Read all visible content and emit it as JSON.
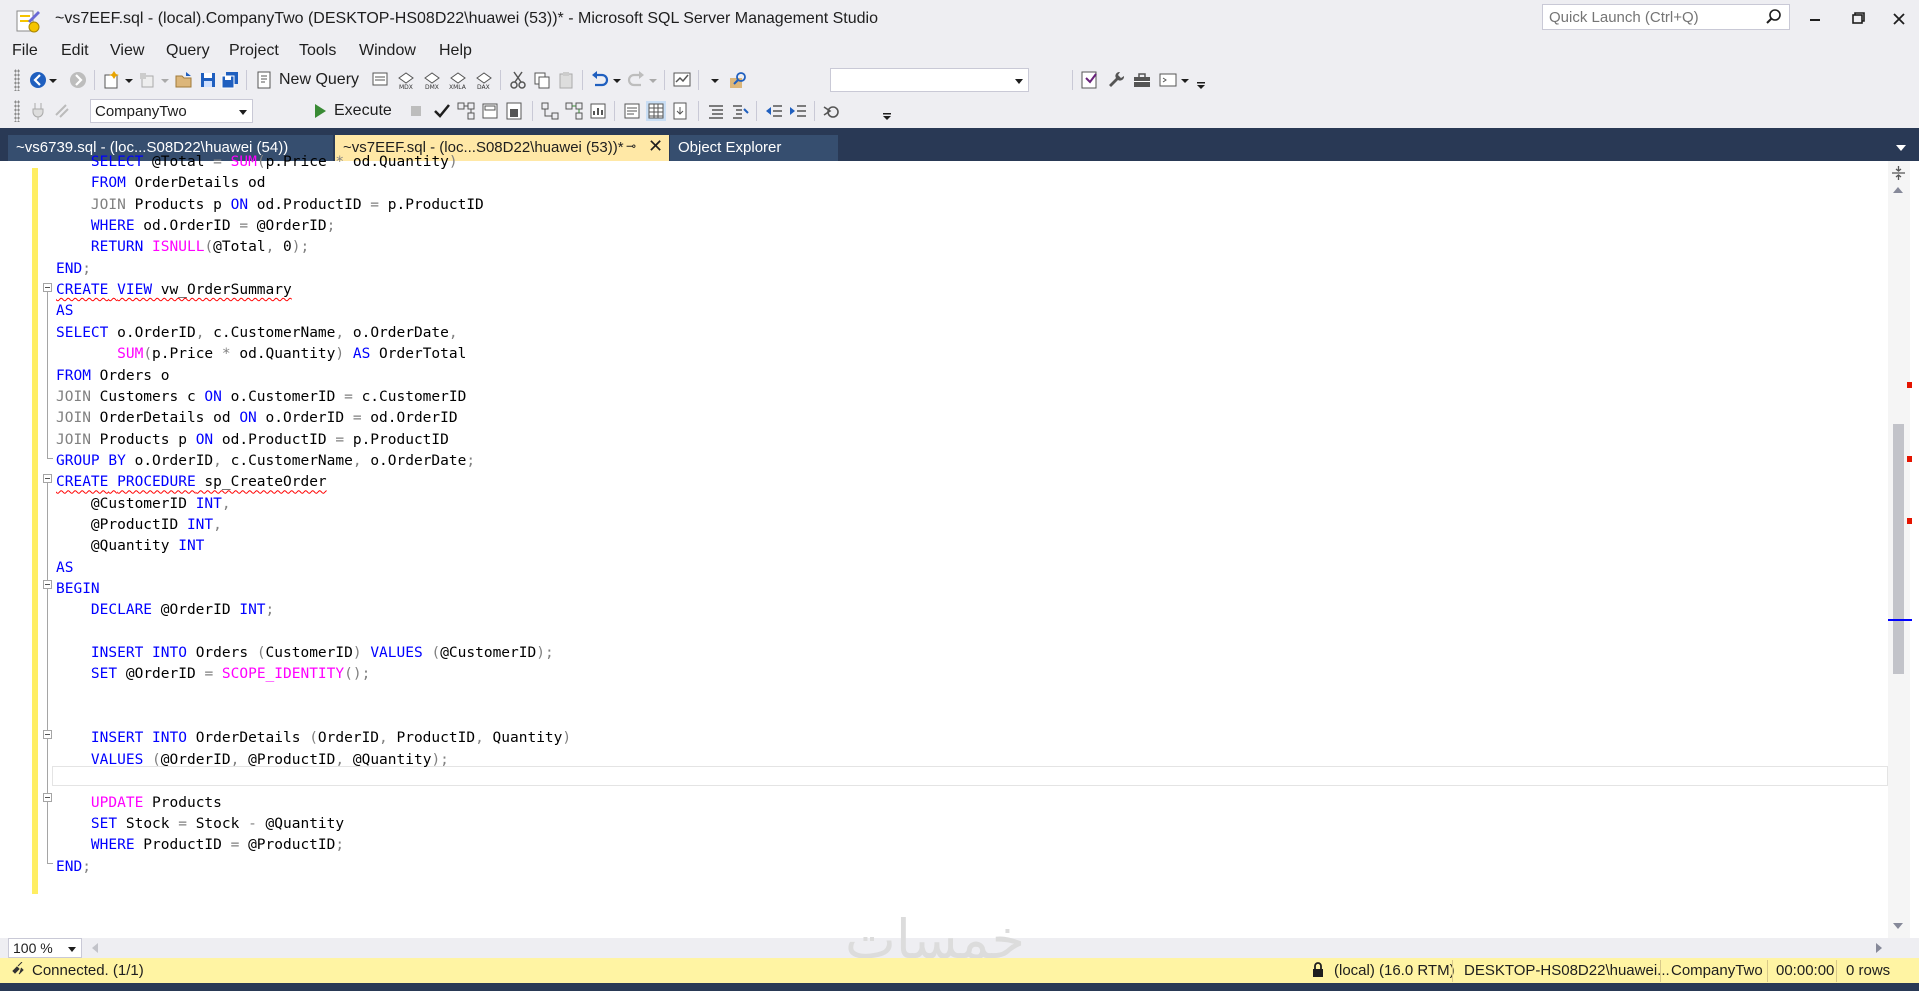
{
  "window": {
    "title": "~vs7EEF.sql - (local).CompanyTwo (DESKTOP-HS08D22\\huawei (53))* - Microsoft SQL Server Management Studio",
    "quick_launch_placeholder": "Quick Launch (Ctrl+Q)"
  },
  "menu": [
    "File",
    "Edit",
    "View",
    "Query",
    "Project",
    "Tools",
    "Window",
    "Help"
  ],
  "toolbar": {
    "new_query_label": "New Query",
    "database": "CompanyTwo",
    "execute_label": "Execute",
    "solution_combo": ""
  },
  "tabs": [
    {
      "label": "~vs6739.sql - (loc...S08D22\\huawei (54))",
      "active": false
    },
    {
      "label": "~vs7EEF.sql - (loc...S08D22\\huawei (53))*",
      "active": true
    },
    {
      "label": "Object Explorer",
      "active": false
    }
  ],
  "editor": {
    "lines": [
      "    SELECT @Total = SUM(p.Price * od.Quantity)",
      "    FROM OrderDetails od",
      "    JOIN Products p ON od.ProductID = p.ProductID",
      "    WHERE od.OrderID = @OrderID;",
      "    RETURN ISNULL(@Total, 0);",
      "END;",
      "CREATE VIEW vw_OrderSummary",
      "AS",
      "SELECT o.OrderID, c.CustomerName, o.OrderDate,",
      "       SUM(p.Price * od.Quantity) AS OrderTotal",
      "FROM Orders o",
      "JOIN Customers c ON o.CustomerID = c.CustomerID",
      "JOIN OrderDetails od ON o.OrderID = od.OrderID",
      "JOIN Products p ON od.ProductID = p.ProductID",
      "GROUP BY o.OrderID, c.CustomerName, o.OrderDate;",
      "CREATE PROCEDURE sp_CreateOrder",
      "    @CustomerID INT,",
      "    @ProductID INT,",
      "    @Quantity INT",
      "AS",
      "BEGIN",
      "    DECLARE @OrderID INT;",
      "",
      "    INSERT INTO Orders (CustomerID) VALUES (@CustomerID);",
      "    SET @OrderID = SCOPE_IDENTITY();",
      "",
      "",
      "    INSERT INTO OrderDetails (OrderID, ProductID, Quantity)",
      "    VALUES (@OrderID, @ProductID, @Quantity);",
      "",
      "    UPDATE Products",
      "    SET Stock = Stock - @Quantity",
      "    WHERE ProductID = @ProductID;",
      "END;"
    ],
    "zoom": "100 %"
  },
  "statusbar": {
    "connection": "Connected. (1/1)",
    "server": "(local) (16.0 RTM)",
    "user": "DESKTOP-HS08D22\\huawei...",
    "database": "CompanyTwo",
    "elapsed": "00:00:00",
    "rows": "0 rows"
  },
  "watermark": "خمسات",
  "colors": {
    "tabstrip": "#293955",
    "active_tab": "#ffe8a6",
    "statusbar": "#fff4a3",
    "keyword": "#0000ff",
    "function": "#ff00ff",
    "operator": "#808080"
  }
}
